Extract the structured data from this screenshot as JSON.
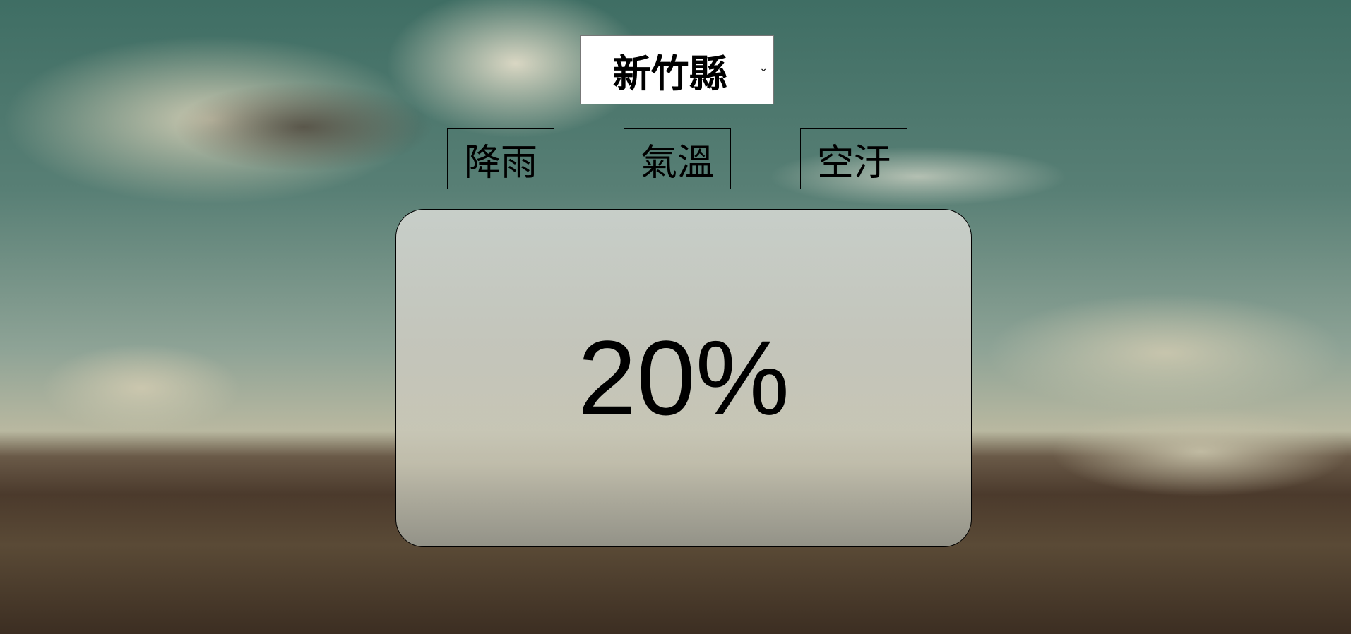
{
  "location_select": {
    "selected": "新竹縣"
  },
  "tabs": [
    {
      "label": "降雨"
    },
    {
      "label": "氣溫"
    },
    {
      "label": "空汙"
    }
  ],
  "display": {
    "value": "20%"
  },
  "icons": {
    "dropdown": "chevron-down-icon"
  }
}
